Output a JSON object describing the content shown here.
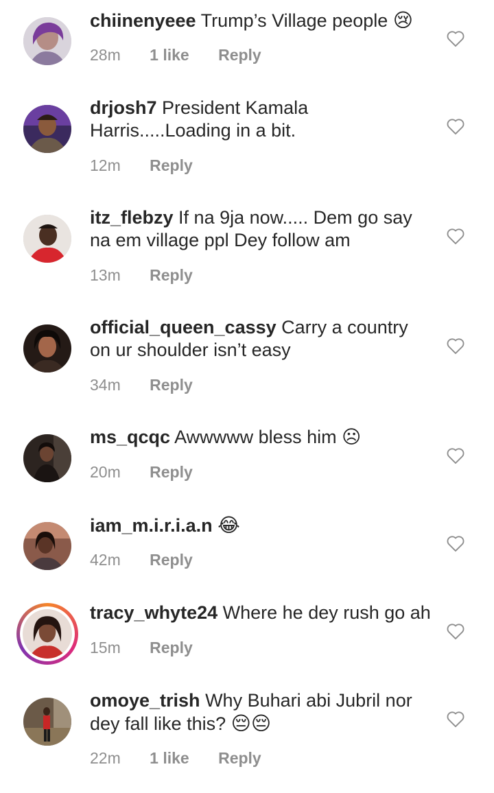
{
  "comments": [
    {
      "username": "chiinenyeee",
      "text": "Trump’s Village people",
      "emoji": "😢",
      "time": "28m",
      "likes": "1 like",
      "reply": "Reply"
    },
    {
      "username": "drjosh7",
      "text": "President Kamala Harris.....Loading in a bit.",
      "emoji": "",
      "time": "12m",
      "likes": "",
      "reply": "Reply"
    },
    {
      "username": "itz_flebzy",
      "text": "If na 9ja now..... Dem go say na em village ppl Dey follow  am",
      "emoji": "",
      "time": "13m",
      "likes": "",
      "reply": "Reply"
    },
    {
      "username": "official_queen_cassy",
      "text": "Carry a country on ur shoulder isn’t easy",
      "emoji": "",
      "time": "34m",
      "likes": "",
      "reply": "Reply"
    },
    {
      "username": "ms_qcqc",
      "text": "Awwwww bless him ☹",
      "emoji": "",
      "time": "20m",
      "likes": "",
      "reply": "Reply"
    },
    {
      "username": "iam_m.i.r.i.a.n",
      "text": "",
      "emoji": "😂",
      "time": "42m",
      "likes": "",
      "reply": "Reply"
    },
    {
      "username": "tracy_whyte24",
      "text": "Where he dey rush go ah",
      "emoji": "",
      "time": "15m",
      "likes": "",
      "reply": "Reply"
    },
    {
      "username": "omoye_trish",
      "text": "Why Buhari abi Jubril nor dey fall like this?",
      "emoji": "😔😔",
      "time": "22m",
      "likes": "1 like",
      "reply": "Reply"
    }
  ]
}
